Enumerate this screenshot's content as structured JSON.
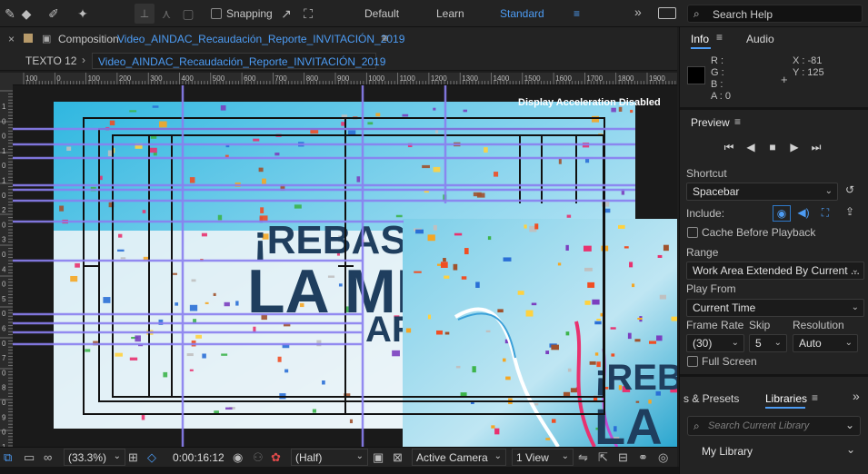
{
  "toolbar": {
    "snapping_label": "Snapping",
    "workspaces": [
      "Default",
      "Learn",
      "Standard"
    ],
    "active_workspace": "Standard",
    "search_placeholder": "Search Help"
  },
  "composition": {
    "panel_label": "Composition",
    "comp_name": "Video_AINDAC_Recaudación_Reporte_INVITACIÓN_2019",
    "layer_tab": "TEXTO 12",
    "breadcrumb": "Video_AINDAC_Recaudación_Reporte_INVITACIÓN_2019",
    "notice": "Display Acceleration Disabled",
    "ruler_top_ticks": [
      "100",
      "0",
      "100",
      "200",
      "300",
      "400",
      "500",
      "600",
      "700",
      "800",
      "900",
      "1000",
      "1100",
      "1200",
      "1300",
      "1400",
      "1500",
      "1600",
      "1700",
      "1800",
      "1900",
      "200"
    ],
    "ruler_left_ticks": [
      "1",
      "0",
      "0",
      "1",
      "0",
      "1",
      "0",
      "2",
      "0",
      "3",
      "0",
      "4",
      "0",
      "5",
      "0",
      "6",
      "0",
      "7",
      "0",
      "8",
      "0",
      "9",
      "0",
      "1"
    ],
    "text_rebasam": "¡REBASAM",
    "text_lamet": "LA MET",
    "text_ar": "AR",
    "text_reba2": "¡REBA",
    "text_la2": "LA M"
  },
  "comp_bottom": {
    "zoom": "(33.3%)",
    "timecode": "0:00:16:12",
    "resolution": "(Half)",
    "camera": "Active Camera",
    "view": "1 View"
  },
  "info": {
    "tab_info": "Info",
    "tab_audio": "Audio",
    "r": "R :",
    "g": "G :",
    "b": "B :",
    "a": "A :  0",
    "x": "X : -81",
    "y": "Y : 125"
  },
  "preview": {
    "title": "Preview",
    "shortcut_label": "Shortcut",
    "shortcut_value": "Spacebar",
    "include_label": "Include:",
    "cache_label": "Cache Before Playback",
    "range_label": "Range",
    "range_value": "Work Area Extended By Current ...",
    "play_from_label": "Play From",
    "play_from_value": "Current Time",
    "frame_rate_label": "Frame Rate",
    "skip_label": "Skip",
    "resolution_label": "Resolution",
    "frame_rate_value": "(30)",
    "skip_value": "5",
    "resolution_value": "Auto",
    "full_screen_label": "Full Screen"
  },
  "libraries": {
    "effects_tab": "s & Presets",
    "libraries_tab": "Libraries",
    "search_placeholder": "Search Current Library",
    "library_value": "My Library"
  },
  "colors": {
    "accent": "#4d9cf4",
    "guide": "#8a7ff0",
    "panel": "#232323"
  }
}
